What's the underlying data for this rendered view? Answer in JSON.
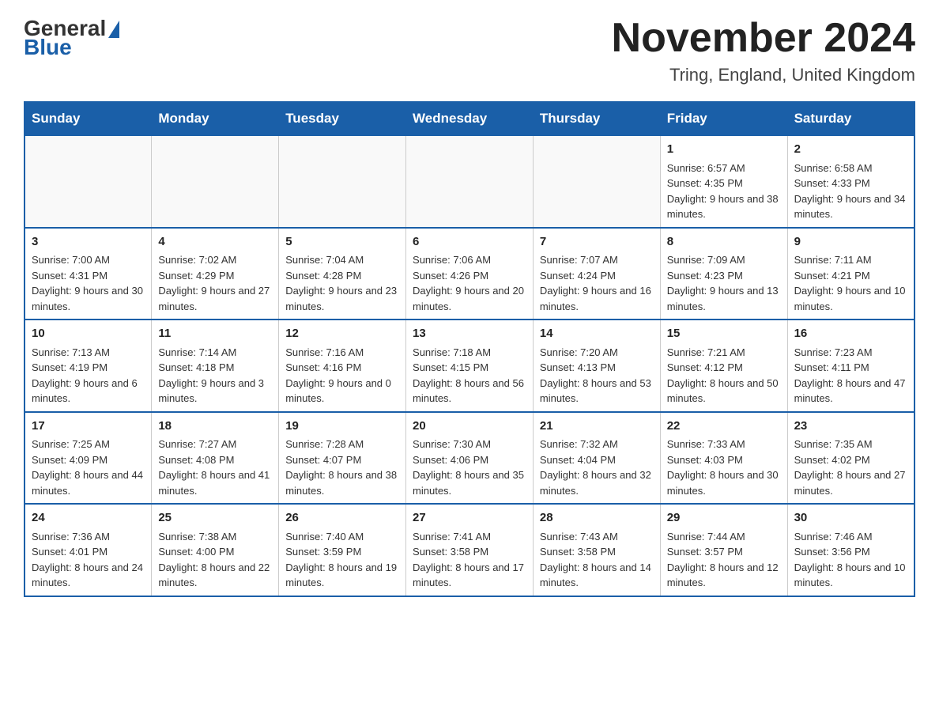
{
  "header": {
    "logo_general": "General",
    "logo_blue": "Blue",
    "month_title": "November 2024",
    "location": "Tring, England, United Kingdom"
  },
  "weekdays": [
    "Sunday",
    "Monday",
    "Tuesday",
    "Wednesday",
    "Thursday",
    "Friday",
    "Saturday"
  ],
  "weeks": [
    [
      {
        "day": "",
        "data": []
      },
      {
        "day": "",
        "data": []
      },
      {
        "day": "",
        "data": []
      },
      {
        "day": "",
        "data": []
      },
      {
        "day": "",
        "data": []
      },
      {
        "day": "1",
        "data": [
          "Sunrise: 6:57 AM",
          "Sunset: 4:35 PM",
          "Daylight: 9 hours and 38 minutes."
        ]
      },
      {
        "day": "2",
        "data": [
          "Sunrise: 6:58 AM",
          "Sunset: 4:33 PM",
          "Daylight: 9 hours and 34 minutes."
        ]
      }
    ],
    [
      {
        "day": "3",
        "data": [
          "Sunrise: 7:00 AM",
          "Sunset: 4:31 PM",
          "Daylight: 9 hours and 30 minutes."
        ]
      },
      {
        "day": "4",
        "data": [
          "Sunrise: 7:02 AM",
          "Sunset: 4:29 PM",
          "Daylight: 9 hours and 27 minutes."
        ]
      },
      {
        "day": "5",
        "data": [
          "Sunrise: 7:04 AM",
          "Sunset: 4:28 PM",
          "Daylight: 9 hours and 23 minutes."
        ]
      },
      {
        "day": "6",
        "data": [
          "Sunrise: 7:06 AM",
          "Sunset: 4:26 PM",
          "Daylight: 9 hours and 20 minutes."
        ]
      },
      {
        "day": "7",
        "data": [
          "Sunrise: 7:07 AM",
          "Sunset: 4:24 PM",
          "Daylight: 9 hours and 16 minutes."
        ]
      },
      {
        "day": "8",
        "data": [
          "Sunrise: 7:09 AM",
          "Sunset: 4:23 PM",
          "Daylight: 9 hours and 13 minutes."
        ]
      },
      {
        "day": "9",
        "data": [
          "Sunrise: 7:11 AM",
          "Sunset: 4:21 PM",
          "Daylight: 9 hours and 10 minutes."
        ]
      }
    ],
    [
      {
        "day": "10",
        "data": [
          "Sunrise: 7:13 AM",
          "Sunset: 4:19 PM",
          "Daylight: 9 hours and 6 minutes."
        ]
      },
      {
        "day": "11",
        "data": [
          "Sunrise: 7:14 AM",
          "Sunset: 4:18 PM",
          "Daylight: 9 hours and 3 minutes."
        ]
      },
      {
        "day": "12",
        "data": [
          "Sunrise: 7:16 AM",
          "Sunset: 4:16 PM",
          "Daylight: 9 hours and 0 minutes."
        ]
      },
      {
        "day": "13",
        "data": [
          "Sunrise: 7:18 AM",
          "Sunset: 4:15 PM",
          "Daylight: 8 hours and 56 minutes."
        ]
      },
      {
        "day": "14",
        "data": [
          "Sunrise: 7:20 AM",
          "Sunset: 4:13 PM",
          "Daylight: 8 hours and 53 minutes."
        ]
      },
      {
        "day": "15",
        "data": [
          "Sunrise: 7:21 AM",
          "Sunset: 4:12 PM",
          "Daylight: 8 hours and 50 minutes."
        ]
      },
      {
        "day": "16",
        "data": [
          "Sunrise: 7:23 AM",
          "Sunset: 4:11 PM",
          "Daylight: 8 hours and 47 minutes."
        ]
      }
    ],
    [
      {
        "day": "17",
        "data": [
          "Sunrise: 7:25 AM",
          "Sunset: 4:09 PM",
          "Daylight: 8 hours and 44 minutes."
        ]
      },
      {
        "day": "18",
        "data": [
          "Sunrise: 7:27 AM",
          "Sunset: 4:08 PM",
          "Daylight: 8 hours and 41 minutes."
        ]
      },
      {
        "day": "19",
        "data": [
          "Sunrise: 7:28 AM",
          "Sunset: 4:07 PM",
          "Daylight: 8 hours and 38 minutes."
        ]
      },
      {
        "day": "20",
        "data": [
          "Sunrise: 7:30 AM",
          "Sunset: 4:06 PM",
          "Daylight: 8 hours and 35 minutes."
        ]
      },
      {
        "day": "21",
        "data": [
          "Sunrise: 7:32 AM",
          "Sunset: 4:04 PM",
          "Daylight: 8 hours and 32 minutes."
        ]
      },
      {
        "day": "22",
        "data": [
          "Sunrise: 7:33 AM",
          "Sunset: 4:03 PM",
          "Daylight: 8 hours and 30 minutes."
        ]
      },
      {
        "day": "23",
        "data": [
          "Sunrise: 7:35 AM",
          "Sunset: 4:02 PM",
          "Daylight: 8 hours and 27 minutes."
        ]
      }
    ],
    [
      {
        "day": "24",
        "data": [
          "Sunrise: 7:36 AM",
          "Sunset: 4:01 PM",
          "Daylight: 8 hours and 24 minutes."
        ]
      },
      {
        "day": "25",
        "data": [
          "Sunrise: 7:38 AM",
          "Sunset: 4:00 PM",
          "Daylight: 8 hours and 22 minutes."
        ]
      },
      {
        "day": "26",
        "data": [
          "Sunrise: 7:40 AM",
          "Sunset: 3:59 PM",
          "Daylight: 8 hours and 19 minutes."
        ]
      },
      {
        "day": "27",
        "data": [
          "Sunrise: 7:41 AM",
          "Sunset: 3:58 PM",
          "Daylight: 8 hours and 17 minutes."
        ]
      },
      {
        "day": "28",
        "data": [
          "Sunrise: 7:43 AM",
          "Sunset: 3:58 PM",
          "Daylight: 8 hours and 14 minutes."
        ]
      },
      {
        "day": "29",
        "data": [
          "Sunrise: 7:44 AM",
          "Sunset: 3:57 PM",
          "Daylight: 8 hours and 12 minutes."
        ]
      },
      {
        "day": "30",
        "data": [
          "Sunrise: 7:46 AM",
          "Sunset: 3:56 PM",
          "Daylight: 8 hours and 10 minutes."
        ]
      }
    ]
  ]
}
